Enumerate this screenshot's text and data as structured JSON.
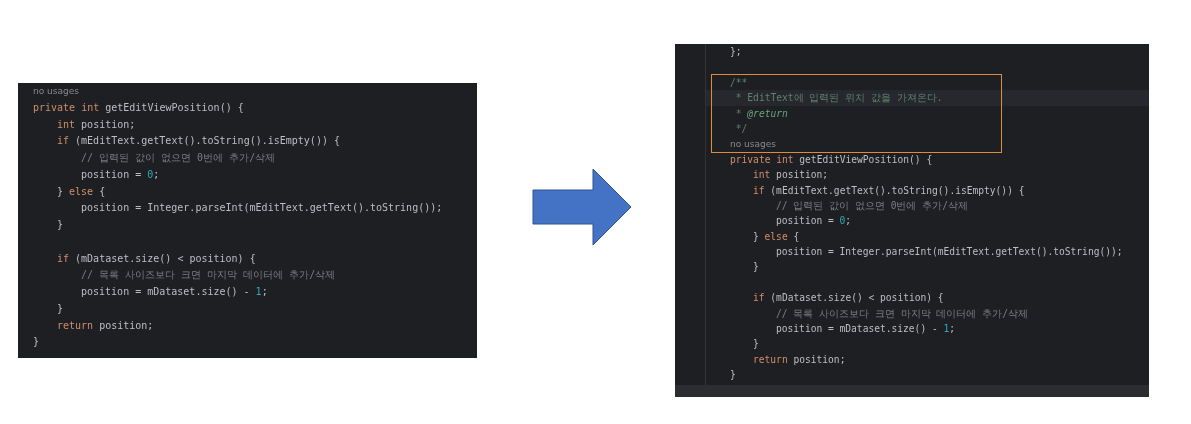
{
  "before_editor": {
    "lines": [
      {
        "kind": "code",
        "tokens": [
          {
            "kind": "hint",
            "text": "no usages"
          }
        ]
      },
      {
        "kind": "code",
        "tokens": [
          {
            "kind": "kw",
            "text": "private int "
          },
          {
            "kind": "plain",
            "text": "getEditViewPosition() {"
          }
        ],
        "children": [
          {
            "kind": "code",
            "tokens": [
              {
                "kind": "kw",
                "text": "int "
              },
              {
                "kind": "plain",
                "text": "position;"
              }
            ]
          },
          {
            "kind": "code",
            "tokens": [
              {
                "kind": "kw",
                "text": "if "
              },
              {
                "kind": "plain",
                "text": "(mEditText.getText().toString().isEmpty()) {"
              }
            ],
            "children": [
              {
                "kind": "code",
                "tokens": [
                  {
                    "kind": "comment",
                    "text": "// 입력된 값이 없으면 0번에 추가/삭제"
                  }
                ]
              },
              {
                "kind": "code",
                "tokens": [
                  {
                    "kind": "plain",
                    "text": "position = "
                  },
                  {
                    "kind": "num",
                    "text": "0"
                  },
                  {
                    "kind": "plain",
                    "text": ";"
                  }
                ]
              }
            ]
          },
          {
            "kind": "code",
            "tokens": [
              {
                "kind": "plain",
                "text": "} "
              },
              {
                "kind": "kw",
                "text": "else "
              },
              {
                "kind": "plain",
                "text": "{"
              }
            ],
            "children": [
              {
                "kind": "code",
                "tokens": [
                  {
                    "kind": "plain",
                    "text": "position = Integer.parseInt(mEditText.getText().toString());"
                  }
                ]
              }
            ]
          },
          {
            "kind": "code",
            "tokens": [
              {
                "kind": "plain",
                "text": "}"
              }
            ]
          },
          {
            "kind": "blank"
          },
          {
            "kind": "code",
            "tokens": [
              {
                "kind": "kw",
                "text": "if "
              },
              {
                "kind": "plain",
                "text": "(mDataset.size() < position) {"
              }
            ],
            "children": [
              {
                "kind": "code",
                "tokens": [
                  {
                    "kind": "comment",
                    "text": "// 목록 사이즈보다 크면 마지막 데이터에 추가/삭제"
                  }
                ]
              },
              {
                "kind": "code",
                "tokens": [
                  {
                    "kind": "plain",
                    "text": "position = mDataset.size() - "
                  },
                  {
                    "kind": "num",
                    "text": "1"
                  },
                  {
                    "kind": "plain",
                    "text": ";"
                  }
                ]
              }
            ]
          },
          {
            "kind": "code",
            "tokens": [
              {
                "kind": "plain",
                "text": "}"
              }
            ]
          },
          {
            "kind": "code",
            "tokens": [
              {
                "kind": "kw",
                "text": "return "
              },
              {
                "kind": "plain",
                "text": "position;"
              }
            ]
          }
        ]
      },
      {
        "kind": "code",
        "tokens": [
          {
            "kind": "plain",
            "text": "}"
          }
        ]
      }
    ]
  },
  "after_editor": {
    "blocks": [
      {
        "boxed": false,
        "lines": [
          {
            "kind": "code",
            "current": false,
            "tokens": [
              {
                "kind": "plain",
                "text": "};"
              }
            ]
          },
          {
            "kind": "blank",
            "current": false
          }
        ]
      },
      {
        "boxed": true,
        "lines": [
          {
            "kind": "code",
            "current": false,
            "tokens": [
              {
                "kind": "doc",
                "text": "/**"
              }
            ]
          },
          {
            "kind": "code",
            "current": true,
            "tokens": [
              {
                "kind": "doc",
                "text": " * EditText에 입력된 위치 값을 가져온다."
              }
            ]
          },
          {
            "kind": "code",
            "current": false,
            "tokens": [
              {
                "kind": "doc",
                "text": " * "
              },
              {
                "kind": "doctag",
                "text": "@return"
              }
            ]
          },
          {
            "kind": "code",
            "current": false,
            "tokens": [
              {
                "kind": "doc",
                "text": " */"
              }
            ]
          },
          {
            "kind": "code",
            "current": false,
            "tokens": [
              {
                "kind": "hint",
                "text": "no usages"
              }
            ]
          }
        ]
      },
      {
        "boxed": false,
        "lines": [
          {
            "kind": "code",
            "current": false,
            "tokens": [
              {
                "kind": "kw",
                "text": "private int "
              },
              {
                "kind": "plain",
                "text": "getEditViewPosition() {"
              }
            ],
            "children": [
              {
                "kind": "code",
                "current": false,
                "tokens": [
                  {
                    "kind": "kw",
                    "text": "int "
                  },
                  {
                    "kind": "plain",
                    "text": "position;"
                  }
                ]
              },
              {
                "kind": "code",
                "current": false,
                "tokens": [
                  {
                    "kind": "kw",
                    "text": "if "
                  },
                  {
                    "kind": "plain",
                    "text": "(mEditText.getText().toString().isEmpty()) {"
                  }
                ],
                "children": [
                  {
                    "kind": "code",
                    "current": false,
                    "tokens": [
                      {
                        "kind": "comment",
                        "text": "// 입력된 값이 없으면 0번에 추가/삭제"
                      }
                    ]
                  },
                  {
                    "kind": "code",
                    "current": false,
                    "tokens": [
                      {
                        "kind": "plain",
                        "text": "position = "
                      },
                      {
                        "kind": "num",
                        "text": "0"
                      },
                      {
                        "kind": "plain",
                        "text": ";"
                      }
                    ]
                  }
                ]
              },
              {
                "kind": "code",
                "current": false,
                "tokens": [
                  {
                    "kind": "plain",
                    "text": "} "
                  },
                  {
                    "kind": "kw",
                    "text": "else "
                  },
                  {
                    "kind": "plain",
                    "text": "{"
                  }
                ],
                "children": [
                  {
                    "kind": "code",
                    "current": false,
                    "tokens": [
                      {
                        "kind": "plain",
                        "text": "position = Integer.parseInt(mEditText.getText().toString());"
                      }
                    ]
                  }
                ]
              },
              {
                "kind": "code",
                "current": false,
                "tokens": [
                  {
                    "kind": "plain",
                    "text": "}"
                  }
                ]
              },
              {
                "kind": "blank",
                "current": false
              },
              {
                "kind": "code",
                "current": false,
                "tokens": [
                  {
                    "kind": "kw",
                    "text": "if "
                  },
                  {
                    "kind": "plain",
                    "text": "(mDataset.size() < position) {"
                  }
                ],
                "children": [
                  {
                    "kind": "code",
                    "current": false,
                    "tokens": [
                      {
                        "kind": "comment",
                        "text": "// 목록 사이즈보다 크면 마지막 데이터에 추가/삭제"
                      }
                    ]
                  },
                  {
                    "kind": "code",
                    "current": false,
                    "tokens": [
                      {
                        "kind": "plain",
                        "text": "position = mDataset.size() - "
                      },
                      {
                        "kind": "num",
                        "text": "1"
                      },
                      {
                        "kind": "plain",
                        "text": ";"
                      }
                    ]
                  }
                ]
              },
              {
                "kind": "code",
                "current": false,
                "tokens": [
                  {
                    "kind": "plain",
                    "text": "}"
                  }
                ]
              },
              {
                "kind": "code",
                "current": false,
                "tokens": [
                  {
                    "kind": "kw",
                    "text": "return "
                  },
                  {
                    "kind": "plain",
                    "text": "position;"
                  }
                ]
              }
            ]
          },
          {
            "kind": "code",
            "current": false,
            "tokens": [
              {
                "kind": "plain",
                "text": "}"
              }
            ]
          }
        ]
      }
    ]
  }
}
